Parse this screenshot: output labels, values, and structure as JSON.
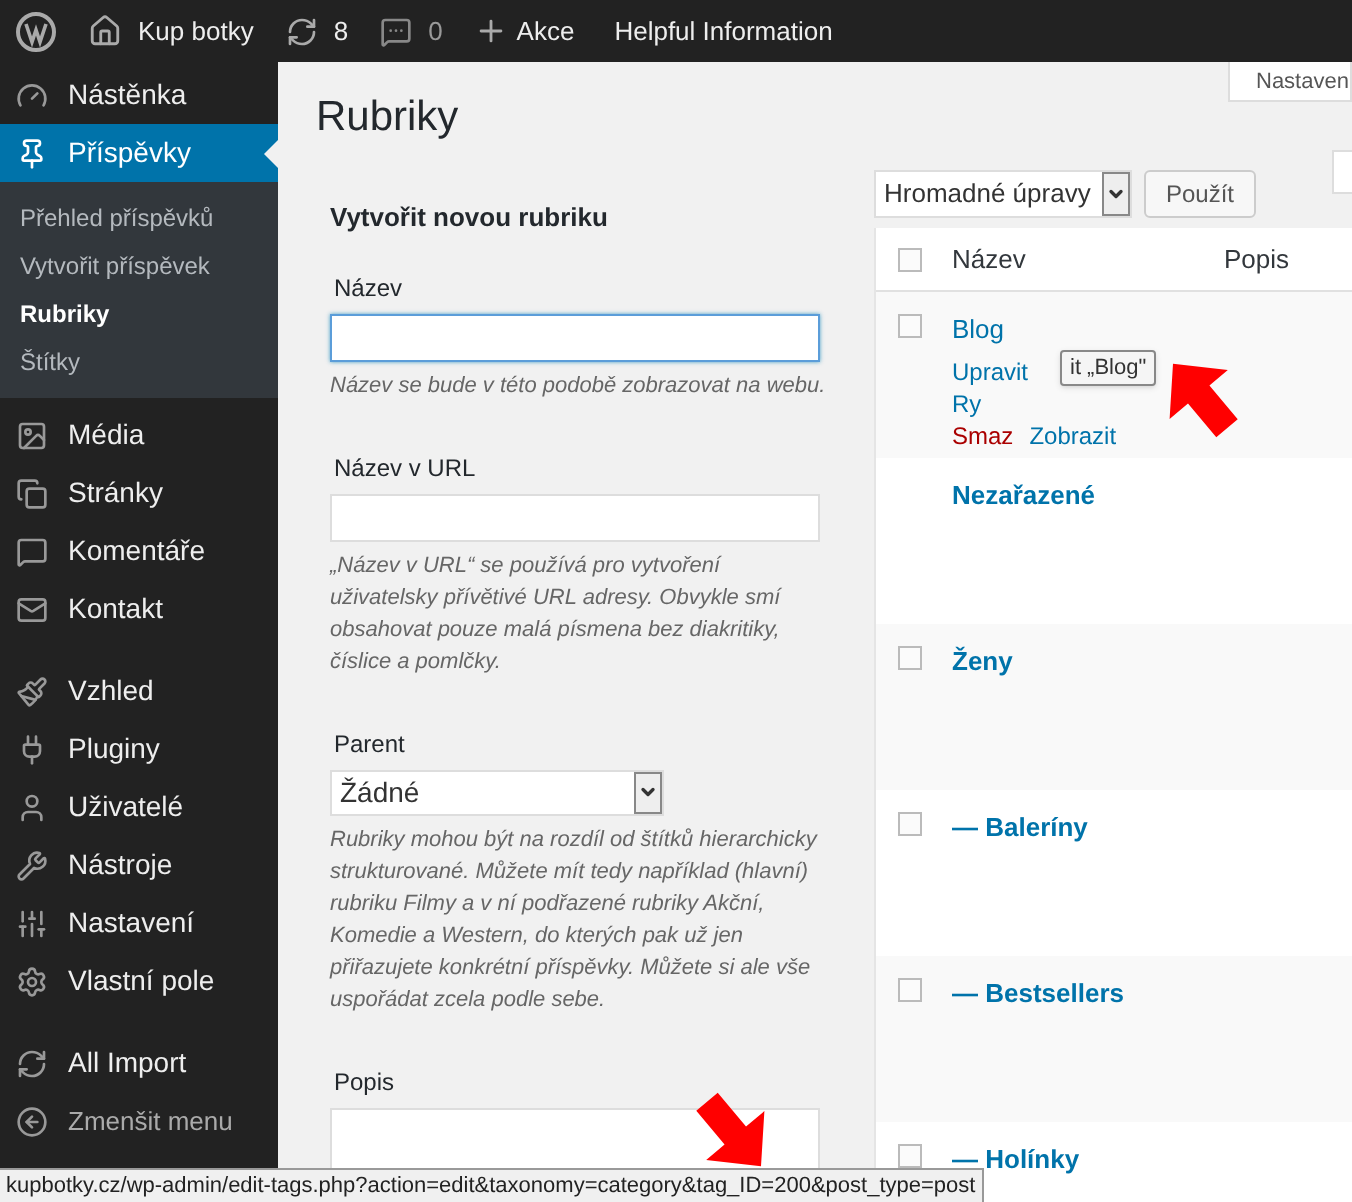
{
  "admin_bar": {
    "site": "Kup botky",
    "updates": "8",
    "comments": "0",
    "new_label": "Akce",
    "extra_link": "Helpful Information"
  },
  "screen_options_tab": "Nastaven",
  "sidebar": {
    "items": [
      {
        "label": "Nástěnka",
        "selected": false
      },
      {
        "label": "Příspěvky",
        "selected": true,
        "children": [
          {
            "label": "Přehled příspěvků",
            "selected": false
          },
          {
            "label": "Vytvořit příspěvek",
            "selected": false
          },
          {
            "label": "Rubriky",
            "selected": true
          },
          {
            "label": "Štítky",
            "selected": false
          }
        ]
      },
      {
        "label": "Média",
        "selected": false
      },
      {
        "label": "Stránky",
        "selected": false
      },
      {
        "label": "Komentáře",
        "selected": false
      },
      {
        "label": "Kontakt",
        "selected": false
      },
      {
        "label": "Vzhled",
        "selected": false
      },
      {
        "label": "Pluginy",
        "selected": false
      },
      {
        "label": "Uživatelé",
        "selected": false
      },
      {
        "label": "Nástroje",
        "selected": false
      },
      {
        "label": "Nastavení",
        "selected": false
      },
      {
        "label": "Vlastní pole",
        "selected": false
      },
      {
        "label": "All Import",
        "selected": false
      }
    ],
    "collapse": "Zmenšit menu"
  },
  "page_title": "Rubriky",
  "form": {
    "heading": "Vytvořit novou rubriku",
    "fields": [
      {
        "kind": "text",
        "label": "Název",
        "focused": true,
        "hint": "Název se bude v této podobě zobrazovat na webu."
      },
      {
        "kind": "text",
        "label": "Název v URL",
        "focused": false,
        "hint": "„Název v URL“ se používá pro vytvoření uživatelsky přívětivé URL adresy. Obvykle smí obsahovat pouze malá písmena bez diakritiky, číslice a pomlčky."
      },
      {
        "kind": "select",
        "label": "Parent",
        "value": "Žádné",
        "hint": "Rubriky mohou být na rozdíl od štítků hierarchicky strukturované. Můžete mít tedy například (hlavní) rubriku Filmy a v ní podřazené rubriky Akční, Komedie a Western, do kterých pak už jen přiřazujete konkrétní příspěvky. Můžete si ale vše uspořádat zcela podle sebe."
      },
      {
        "kind": "textarea",
        "label": "Popis"
      }
    ]
  },
  "table": {
    "bulk_action": "Hromadné úpravy",
    "apply": "Použít",
    "select_all_checked": false,
    "columns": [
      "Název",
      "Popis"
    ],
    "rows": [
      {
        "name": "Blog",
        "kind": "checkable",
        "checked": false,
        "action_lines": [
          [
            {
              "label": "Upravit",
              "kind": "link"
            }
          ],
          [
            {
              "label": "Ry",
              "kind": "link"
            }
          ],
          [
            {
              "label": "Smaz",
              "kind": "delete"
            },
            {
              "label": "Zobrazit",
              "kind": "link"
            }
          ]
        ],
        "tooltip": "it „Blog\""
      },
      {
        "name": "Nezařazené",
        "kind": "default"
      },
      {
        "name": "Ženy",
        "kind": "checkable",
        "checked": false
      },
      {
        "name": "— Baleríny",
        "kind": "checkable",
        "checked": false
      },
      {
        "name": "— Bestsellers",
        "kind": "checkable",
        "checked": false
      },
      {
        "name": "— Holínky",
        "kind": "checkable",
        "checked": false
      }
    ]
  },
  "status_url": "kupbotky.cz/wp-admin/edit-tags.php?action=edit&taxonomy=category&tag_ID=200&post_type=post"
}
